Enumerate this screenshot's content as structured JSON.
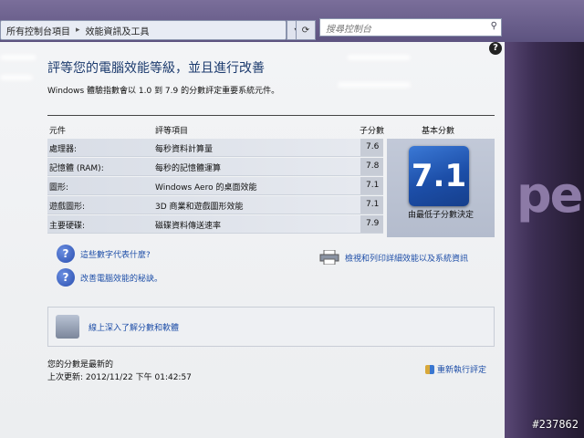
{
  "address": {
    "segments": [
      "所有控制台項目",
      "效能資訊及工具"
    ]
  },
  "search": {
    "placeholder": "搜尋控制台"
  },
  "page": {
    "title": "評等您的電腦效能等級，並且進行改善",
    "subtitle": "Windows 體驗指數會以 1.0 到 7.9 的分數評定重要系統元件。"
  },
  "table": {
    "headers": {
      "component": "元件",
      "rated": "評等項目",
      "subscore": "子分數",
      "base": "基本分數"
    },
    "rows": [
      {
        "component": "處理器:",
        "item": "每秒資料計算量",
        "score": "7.6"
      },
      {
        "component": "記憶體 (RAM):",
        "item": "每秒的記憶體運算",
        "score": "7.8"
      },
      {
        "component": "圖形:",
        "item": "Windows Aero 的桌面效能",
        "score": "7.1"
      },
      {
        "component": "遊戲圖形:",
        "item": "3D 商業和遊戲圖形效能",
        "score": "7.1"
      },
      {
        "component": "主要硬碟:",
        "item": "磁碟資料傳送速率",
        "score": "7.9"
      }
    ],
    "base_score": "7.1",
    "base_caption": "由最低子分數決定"
  },
  "links": {
    "what_mean": "這些數字代表什麼?",
    "improve": "改善電腦效能的秘訣。",
    "print": "檢視和列印詳細效能以及系統資訊",
    "learn_more": "線上深入了解分數和軟體"
  },
  "footer": {
    "status": "您的分數是最新的",
    "last_update": "上次更新: 2012/11/22 下午 01:42:57",
    "rerun": "重新執行評定"
  },
  "watermark": "#237862",
  "desktop_logo": "pe",
  "colors": {
    "accent": "#1f4fa8",
    "tile": "#1c4ea8",
    "title": "#1c3b6e"
  },
  "icons": [
    "back-icon",
    "refresh-icon",
    "search-icon",
    "help-icon",
    "question-icon",
    "printer-icon",
    "shield-icon",
    "tools-icon"
  ]
}
